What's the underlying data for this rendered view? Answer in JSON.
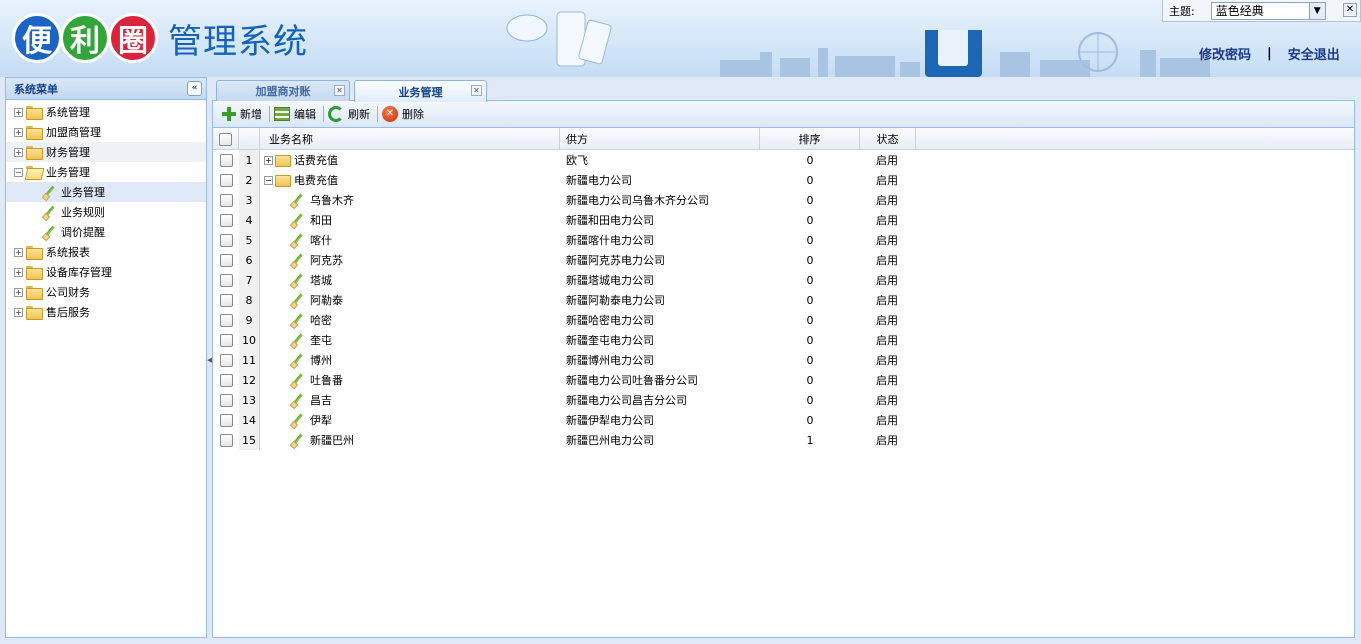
{
  "app": {
    "logo_chars": [
      "便",
      "利",
      "圈"
    ],
    "system_name": "管理系统",
    "theme_label": "主题:",
    "theme_value": "蓝色经典",
    "change_password": "修改密码",
    "logout": "安全退出",
    "separator": "|"
  },
  "sidebar": {
    "title": "系统菜单",
    "items": [
      {
        "label": "系统管理"
      },
      {
        "label": "加盟商管理"
      },
      {
        "label": "财务管理"
      },
      {
        "label": "业务管理"
      },
      {
        "label": "业务管理"
      },
      {
        "label": "业务规则"
      },
      {
        "label": "调价提醒"
      },
      {
        "label": "系统报表"
      },
      {
        "label": "设备库存管理"
      },
      {
        "label": "公司财务"
      },
      {
        "label": "售后服务"
      }
    ]
  },
  "tabs": [
    {
      "label": "加盟商对账"
    },
    {
      "label": "业务管理"
    }
  ],
  "toolbar": {
    "add": "新增",
    "edit": "编辑",
    "refresh": "刷新",
    "delete": "删除"
  },
  "grid": {
    "columns": [
      "业务名称",
      "供方",
      "排序",
      "状态"
    ],
    "rows": [
      {
        "n": "1",
        "name": "话费充值",
        "supplier": "欧飞",
        "order": "0",
        "status": "启用"
      },
      {
        "n": "2",
        "name": "电费充值",
        "supplier": "新疆电力公司",
        "order": "0",
        "status": "启用"
      },
      {
        "n": "3",
        "name": "乌鲁木齐",
        "supplier": "新疆电力公司乌鲁木齐分公司",
        "order": "0",
        "status": "启用"
      },
      {
        "n": "4",
        "name": "和田",
        "supplier": "新疆和田电力公司",
        "order": "0",
        "status": "启用"
      },
      {
        "n": "5",
        "name": "喀什",
        "supplier": "新疆喀什电力公司",
        "order": "0",
        "status": "启用"
      },
      {
        "n": "6",
        "name": "阿克苏",
        "supplier": "新疆阿克苏电力公司",
        "order": "0",
        "status": "启用"
      },
      {
        "n": "7",
        "name": "塔城",
        "supplier": "新疆塔城电力公司",
        "order": "0",
        "status": "启用"
      },
      {
        "n": "8",
        "name": "阿勒泰",
        "supplier": "新疆阿勒泰电力公司",
        "order": "0",
        "status": "启用"
      },
      {
        "n": "9",
        "name": "哈密",
        "supplier": "新疆哈密电力公司",
        "order": "0",
        "status": "启用"
      },
      {
        "n": "10",
        "name": "奎屯",
        "supplier": "新疆奎屯电力公司",
        "order": "0",
        "status": "启用"
      },
      {
        "n": "11",
        "name": "博州",
        "supplier": "新疆博州电力公司",
        "order": "0",
        "status": "启用"
      },
      {
        "n": "12",
        "name": "吐鲁番",
        "supplier": "新疆电力公司吐鲁番分公司",
        "order": "0",
        "status": "启用"
      },
      {
        "n": "13",
        "name": "昌吉",
        "supplier": "新疆电力公司昌吉分公司",
        "order": "0",
        "status": "启用"
      },
      {
        "n": "14",
        "name": "伊犁",
        "supplier": "新疆伊犁电力公司",
        "order": "0",
        "status": "启用"
      },
      {
        "n": "15",
        "name": "新疆巴州",
        "supplier": "新疆巴州电力公司",
        "order": "1",
        "status": "启用"
      }
    ]
  },
  "icons": {
    "add": "plus-icon",
    "edit": "edit-icon",
    "refresh": "refresh-icon",
    "delete": "delete-icon",
    "folder": "folder-icon",
    "leaf": "pencil-icon"
  },
  "colors": {
    "header_bg": "#d3e6f8",
    "panel_border": "#99bbe8",
    "link": "#1b3a8c",
    "logo_blue": "#1b63c4",
    "logo_green": "#32a43a",
    "logo_red": "#d9243c"
  }
}
